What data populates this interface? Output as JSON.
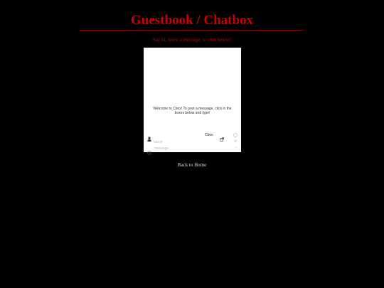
{
  "header": {
    "title": "Guestbook / Chatbox",
    "intro": "Say hi, leave a message, or chat below!"
  },
  "cbox": {
    "welcome": "Welcome to Cbox! To post a message, click in the boxes below and type!",
    "link_label": "Cbox",
    "name_placeholder": "name",
    "name_option": "⚙",
    "message_placeholder": "message",
    "send_label": "›",
    "icons": {
      "user": "user-icon",
      "external": "external-link-icon",
      "emoji": "smiley-icon",
      "circle": "circle-icon"
    }
  },
  "footer": {
    "back_label": "Back to Home"
  },
  "colors": {
    "background": "#000000",
    "accent": "#cc0000",
    "link": "#dddddd"
  }
}
